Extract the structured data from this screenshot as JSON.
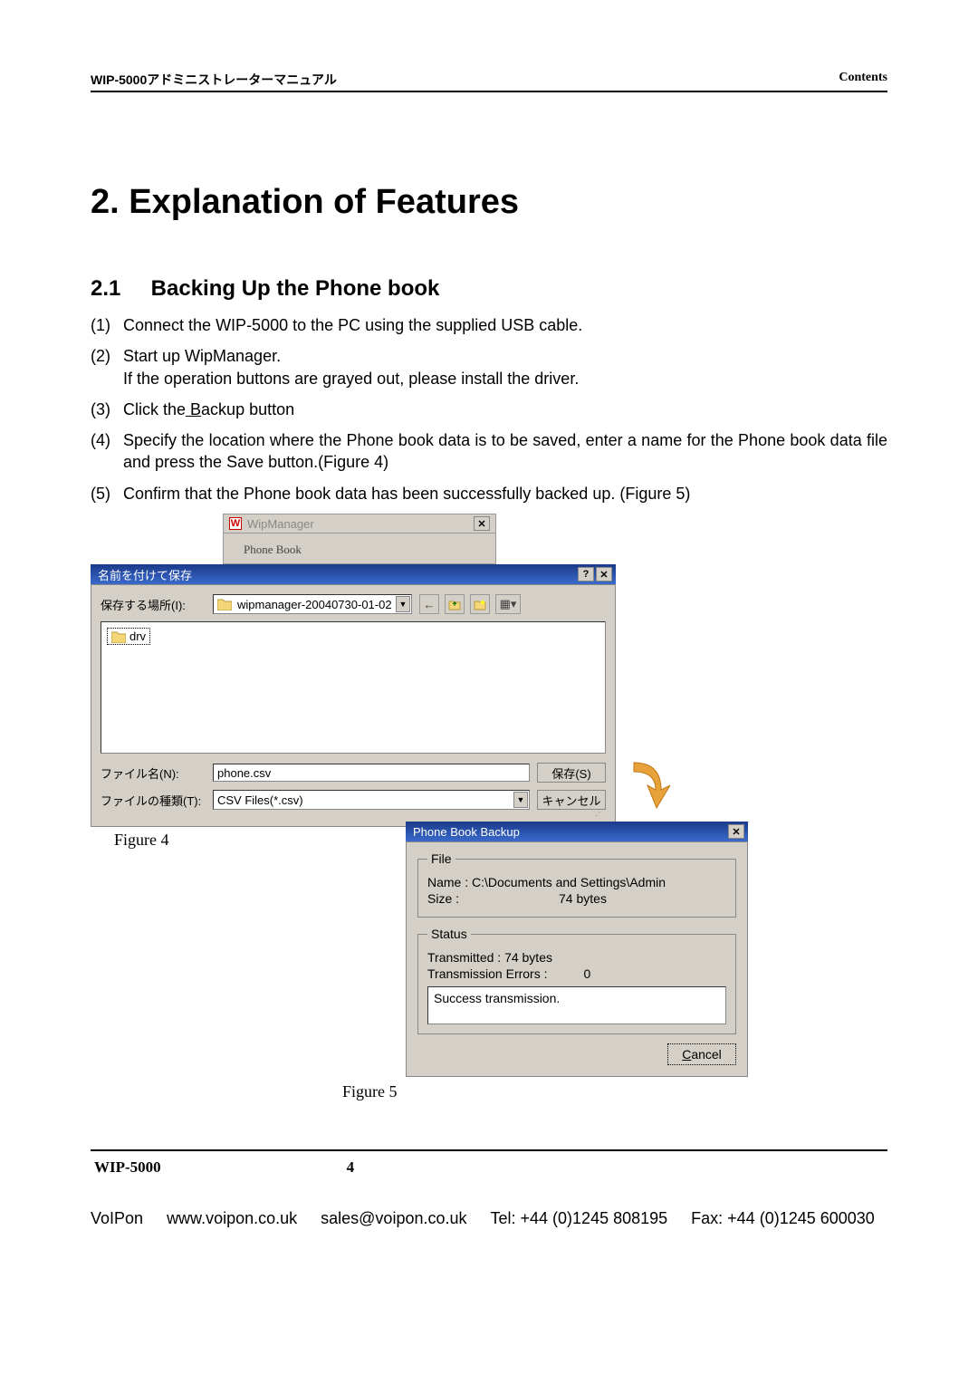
{
  "header": {
    "left": "WIP-5000アドミニストレーターマニュアル",
    "right": "Contents"
  },
  "h1": "2. Explanation of Features",
  "h2": {
    "num": "2.1",
    "title": "Backing Up the Phone book"
  },
  "steps": [
    {
      "n": "(1)",
      "t": "Connect the WIP-5000 to the PC using the supplied USB cable."
    },
    {
      "n": "(2)",
      "t": "Start up WipManager.\nIf the operation buttons are grayed out, please install the driver."
    },
    {
      "n": "(3)",
      "t_pre": "Click the",
      "t_u": " B",
      "t_post": "ackup button"
    },
    {
      "n": "(4)",
      "t": "Specify the location where the Phone book data is to be saved, enter a name for the Phone book data file and press the Save button.(Figure 4)"
    },
    {
      "n": "(5)",
      "t": "Confirm that the Phone book data has been successfully backed up. (Figure 5)"
    }
  ],
  "wipmgr": {
    "title": "WipManager",
    "group": "Phone Book"
  },
  "dlg4": {
    "title": "名前を付けて保存",
    "saveInLabel": "保存する場所(I):",
    "saveInValue": "wipmanager-20040730-01-02",
    "folderItem": "drv",
    "fileNameLabel": "ファイル名(N):",
    "fileNameValue": "phone.csv",
    "fileTypeLabel": "ファイルの種類(T):",
    "fileTypeValue": "CSV Files(*.csv)",
    "saveBtn": "保存(S)",
    "cancelBtn": "キャンセル"
  },
  "cap4": "Figure 4",
  "dlg5": {
    "title": "Phone Book Backup",
    "fileLegend": "File",
    "nameLabel": "Name :",
    "nameValue": "C:\\Documents and Settings\\Admin",
    "sizeLabel": "Size :",
    "sizeValue": "74 bytes",
    "statusLegend": "Status",
    "transmittedLabel": "Transmitted :",
    "transmittedValue": "74 bytes",
    "errorsLabel": "Transmission Errors :",
    "errorsValue": "0",
    "message": "Success transmission.",
    "cancelBtn": "Cancel"
  },
  "cap5": "Figure 5",
  "footer1": {
    "model": "WIP-5000",
    "page": "4"
  },
  "footer2": {
    "brand": "VoIPon",
    "url": "www.voipon.co.uk",
    "email": "sales@voipon.co.uk",
    "tel": "Tel: +44 (0)1245 808195",
    "fax": "Fax: +44 (0)1245 600030"
  }
}
